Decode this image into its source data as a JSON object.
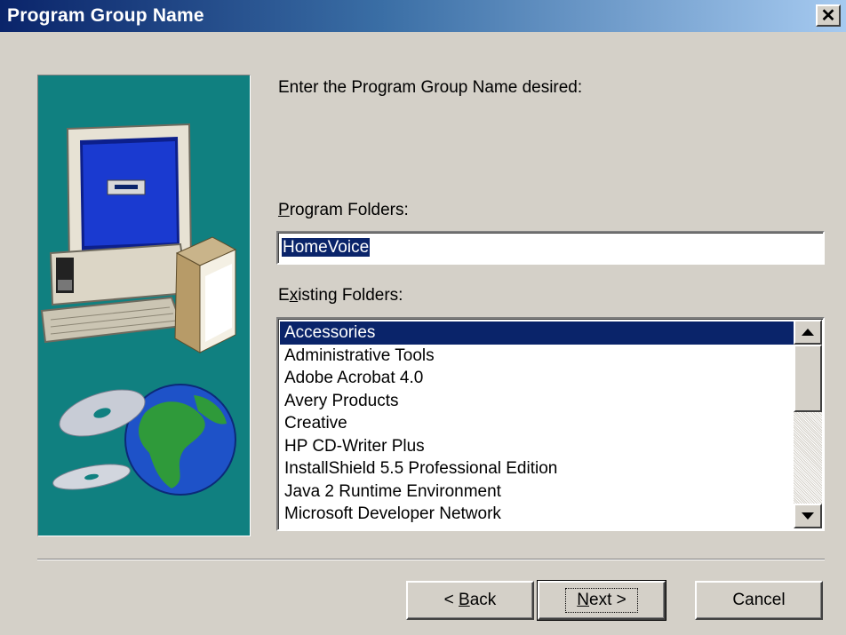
{
  "window": {
    "title": "Program Group Name",
    "close_symbol": "✕"
  },
  "content": {
    "instruction": "Enter the Program Group Name desired:",
    "program_folders_label_accel": "P",
    "program_folders_label_rest": "rogram Folders:",
    "program_folder_value": "HomeVoice",
    "existing_folders_label_pre": "E",
    "existing_folders_label_accel": "x",
    "existing_folders_label_rest": "isting Folders:",
    "existing_folders": [
      "Accessories",
      "Administrative Tools",
      "Adobe Acrobat 4.0",
      "Avery Products",
      "Creative",
      "HP CD-Writer Plus",
      "InstallShield 5.5 Professional Edition",
      "Java 2 Runtime Environment",
      "Microsoft Developer Network"
    ],
    "selected_folder": "Accessories"
  },
  "buttons": {
    "back_pre": "< ",
    "back_accel": "B",
    "back_rest": "ack",
    "next_accel": "N",
    "next_rest": "ext >",
    "cancel": "Cancel"
  },
  "icons": {
    "close": "close-icon",
    "scroll_up": "scroll-up-arrow-icon",
    "scroll_down": "scroll-down-arrow-icon",
    "illustration": "computer-box-cd-globe-illustration"
  },
  "colors": {
    "title_bar_start": "#0a246a",
    "title_bar_end": "#a6caf0",
    "dialog_face": "#d4d0c8",
    "illustration_background": "#108080",
    "selection": "#0a246a"
  }
}
